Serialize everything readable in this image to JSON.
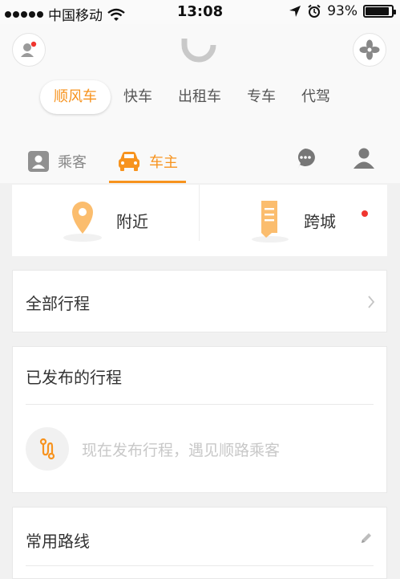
{
  "status_bar": {
    "carrier": "中国移动",
    "time": "13:08",
    "battery": "93%",
    "battery_level": 0.93
  },
  "header": {
    "icons": [
      "user-notify-icon",
      "didi-logo",
      "fan-icon"
    ],
    "service_tabs": [
      "顺风车",
      "快车",
      "出租车",
      "专车",
      "代驾"
    ],
    "active_tab": "顺风车",
    "roles": {
      "passenger": "乘客",
      "driver": "车主"
    },
    "active_role": "车主",
    "accent_color": "#f7931e"
  },
  "modes": {
    "nearby": "附近",
    "intercity": "跨城"
  },
  "all_trips": {
    "title": "全部行程"
  },
  "published": {
    "title": "已发布的行程",
    "empty_text": "现在发布行程，遇见顺路乘客"
  },
  "routes": {
    "title": "常用路线"
  }
}
